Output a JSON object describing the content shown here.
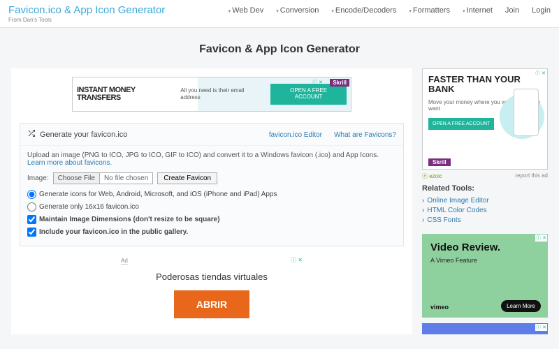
{
  "header": {
    "brand": "Favicon.ico & App Icon Generator",
    "brand_sub": "From Dan's Tools",
    "nav": [
      "Web Dev",
      "Conversion",
      "Encode/Decoders",
      "Formatters",
      "Internet"
    ],
    "join": "Join",
    "login": "Login"
  },
  "page_title": "Favicon & App Icon Generator",
  "banner": {
    "title": "INSTANT MONEY TRANSFERS",
    "sub": "All you need is their email address",
    "cta": "OPEN A FREE ACCOUNT",
    "brand": "Skrill"
  },
  "panel": {
    "title": "Generate your favicon.ico",
    "link1": "favicon.ico Editor",
    "link2": "What are Favicons?",
    "desc": "Upload an image (PNG to ICO, JPG to ICO, GIF to ICO) and convert it to a Windows favicon (.ico) and App Icons. ",
    "desc_link": "Learn more about favicons.",
    "image_label": "Image:",
    "choose_file": "Choose File",
    "no_file": "No file chosen",
    "create_btn": "Create Favicon",
    "opt1": "Generate icons for Web, Android, Microsoft, and iOS (iPhone and iPad) Apps",
    "opt2": "Generate only 16x16 favicon.ico",
    "opt3": "Maintain Image Dimensions (don't resize to be square)",
    "opt4": "Include your favicon.ico in the public gallery."
  },
  "mid_ad": {
    "label": "Ad",
    "title": "Poderosas tiendas virtuales",
    "btn": "ABRIR"
  },
  "side_ad1": {
    "h": "FASTER THAN YOUR BANK",
    "s": "Move your money where you want, when you want",
    "b": "OPEN A FREE ACCOUNT",
    "sk": "Skrill"
  },
  "ezoic": {
    "brand": "ezoic",
    "report": "report this ad"
  },
  "related": {
    "title": "Related Tools:",
    "links": [
      "Online Image Editor",
      "HTML Color Codes",
      "CSS Fonts"
    ]
  },
  "side_ad2": {
    "t": "Video Review.",
    "s": "A Vimeo Feature",
    "v": "vimeo",
    "lm": "Learn More"
  }
}
